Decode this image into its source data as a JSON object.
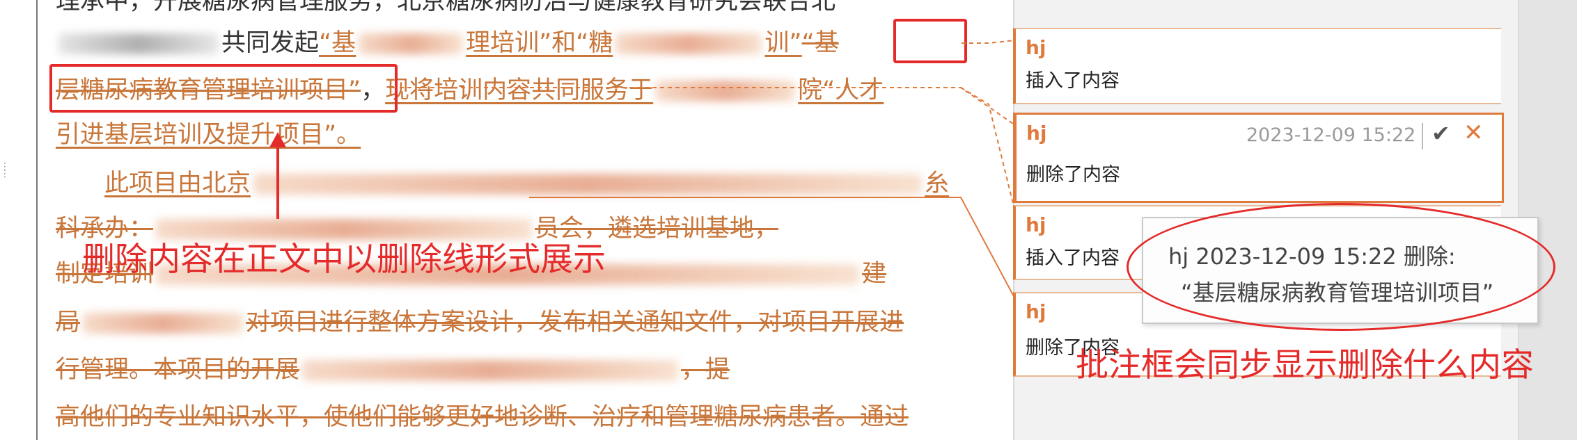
{
  "document": {
    "line0_text": "理承中，开展糖尿病管理服务，北京糖尿病防治与健康教育研究会联合北",
    "line1": {
      "mid": "共同发起",
      "ins_a": "“基",
      "ins_b": "理培训”和“糖",
      "ins_c": "训”",
      "ins_d": "“基"
    },
    "line2": {
      "del": "层糖尿病教育管理培训项目”",
      "comma": "，",
      "ins_a": "现将培训内容共同服务于",
      "ins_b": "院“人才"
    },
    "line3_ins": "引进基层培训及提升项目”。",
    "line4_ins": "此项目由北京",
    "line4_end": "糸",
    "line5": {
      "a": "科承办：",
      "b": "员会，遴选培训基地，"
    },
    "line6": {
      "a": "制定培训",
      "b": "建"
    },
    "line7": {
      "a": "局",
      "b": "对项目进行整体方案设计，发布相关通知文件，对项目开展进"
    },
    "line8": {
      "a": "行管理。本项目的开展",
      "b": "，提"
    },
    "line9_del": "高他们的专业知识水平，使他们能够更好地诊断、治疗和管理糖尿病患者。通过"
  },
  "annotations": {
    "strike_note": "删除内容在正文中以删除线形式展示",
    "balloon_note": "批注框会同步显示删除什么内容"
  },
  "balloons": [
    {
      "author": "hj",
      "action": "插入了内容"
    },
    {
      "author": "hj",
      "action": "删除了内容",
      "time": "2023-12-09 15:22",
      "accept_icon": "✔",
      "reject_icon": "✕"
    },
    {
      "author": "hj",
      "action": "插入了内容"
    },
    {
      "author": "hj",
      "action": "删除了内容"
    }
  ],
  "tooltip": {
    "line1": "hj 2023-12-09 15:22 删除:",
    "line2": "“基层糖尿病教育管理培训项目”"
  },
  "colors": {
    "revision": "#c8763a",
    "highlight_red": "#e52a2a",
    "balloon_border": "#e07a3c"
  }
}
